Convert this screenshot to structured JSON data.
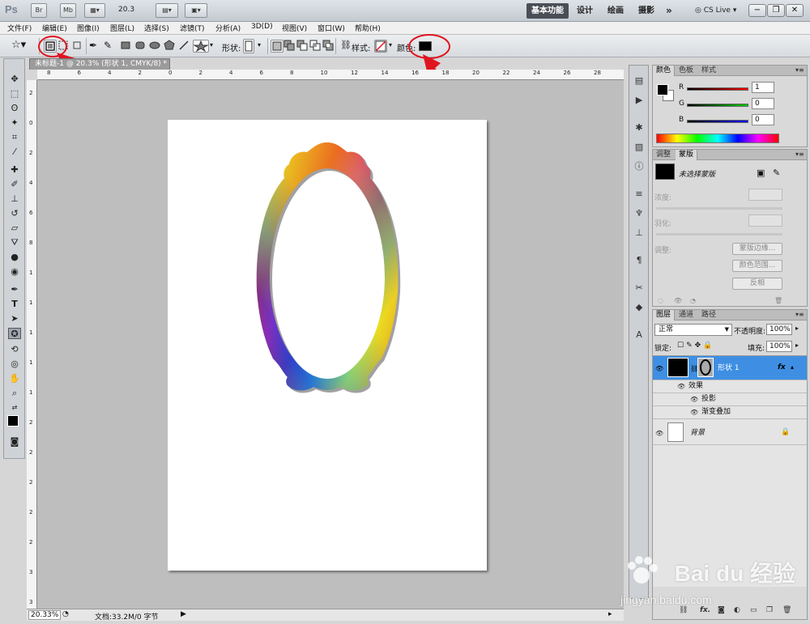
{
  "titlebar": {
    "app_logo": "Ps",
    "br": "Br",
    "mb": "Mb",
    "zoom": "20.3",
    "workspaces": [
      "基本功能",
      "设计",
      "绘画",
      "摄影"
    ],
    "more": "»",
    "cs_live": "CS Live"
  },
  "menu": [
    "文件(F)",
    "编辑(E)",
    "图像(I)",
    "图层(L)",
    "选择(S)",
    "滤镜(T)",
    "分析(A)",
    "3D(D)",
    "视图(V)",
    "窗口(W)",
    "帮助(H)"
  ],
  "options": {
    "shape_label": "形状:",
    "style_label": "样式:",
    "color_label": "颜色:",
    "color_value": "#000000"
  },
  "document": {
    "tab_title": "未标题-1 @ 20.3% (形状 1, CMYK/8) *",
    "zoom": "20.33%",
    "doc_info": "文档:33.2M/0 字节"
  },
  "ruler": {
    "top": [
      "8",
      "6",
      "4",
      "2",
      "0",
      "2",
      "4",
      "6",
      "8",
      "10",
      "12",
      "14",
      "16",
      "18",
      "20",
      "22",
      "24",
      "26",
      "28"
    ],
    "left": [
      "2",
      "0",
      "2",
      "4",
      "6",
      "8",
      "1",
      "1",
      "1",
      "1",
      "1",
      "2",
      "2",
      "2",
      "2",
      "2",
      "3",
      "3"
    ]
  },
  "color_panel": {
    "tabs": [
      "颜色",
      "色板",
      "样式"
    ],
    "channels": [
      {
        "label": "R",
        "value": "1"
      },
      {
        "label": "G",
        "value": "0"
      },
      {
        "label": "B",
        "value": "0"
      }
    ]
  },
  "masks_panel": {
    "tabs": [
      "调整",
      "蒙版"
    ],
    "status": "未选择蒙版",
    "density_label": "浓度:",
    "feather_label": "羽化:",
    "refine_label": "调整:",
    "buttons": [
      "蒙版边缘...",
      "颜色范围...",
      "反相"
    ]
  },
  "layers_panel": {
    "tabs": [
      "图层",
      "通道",
      "路径"
    ],
    "blend_mode": "正常",
    "opacity_label": "不透明度:",
    "opacity": "100%",
    "lock_label": "锁定:",
    "fill_label": "填充:",
    "fill": "100%",
    "layers": [
      {
        "name": "形状 1",
        "fx": "fx"
      },
      {
        "name": "效果"
      },
      {
        "name": "投影"
      },
      {
        "name": "渐变叠加"
      },
      {
        "name": "背景"
      }
    ]
  },
  "watermark": {
    "brand": "Bai du 经验",
    "url": "jingyan.baidu.com"
  },
  "colors": {
    "accent_red": "#e0141e",
    "selected_layer": "#3e8fe3"
  }
}
